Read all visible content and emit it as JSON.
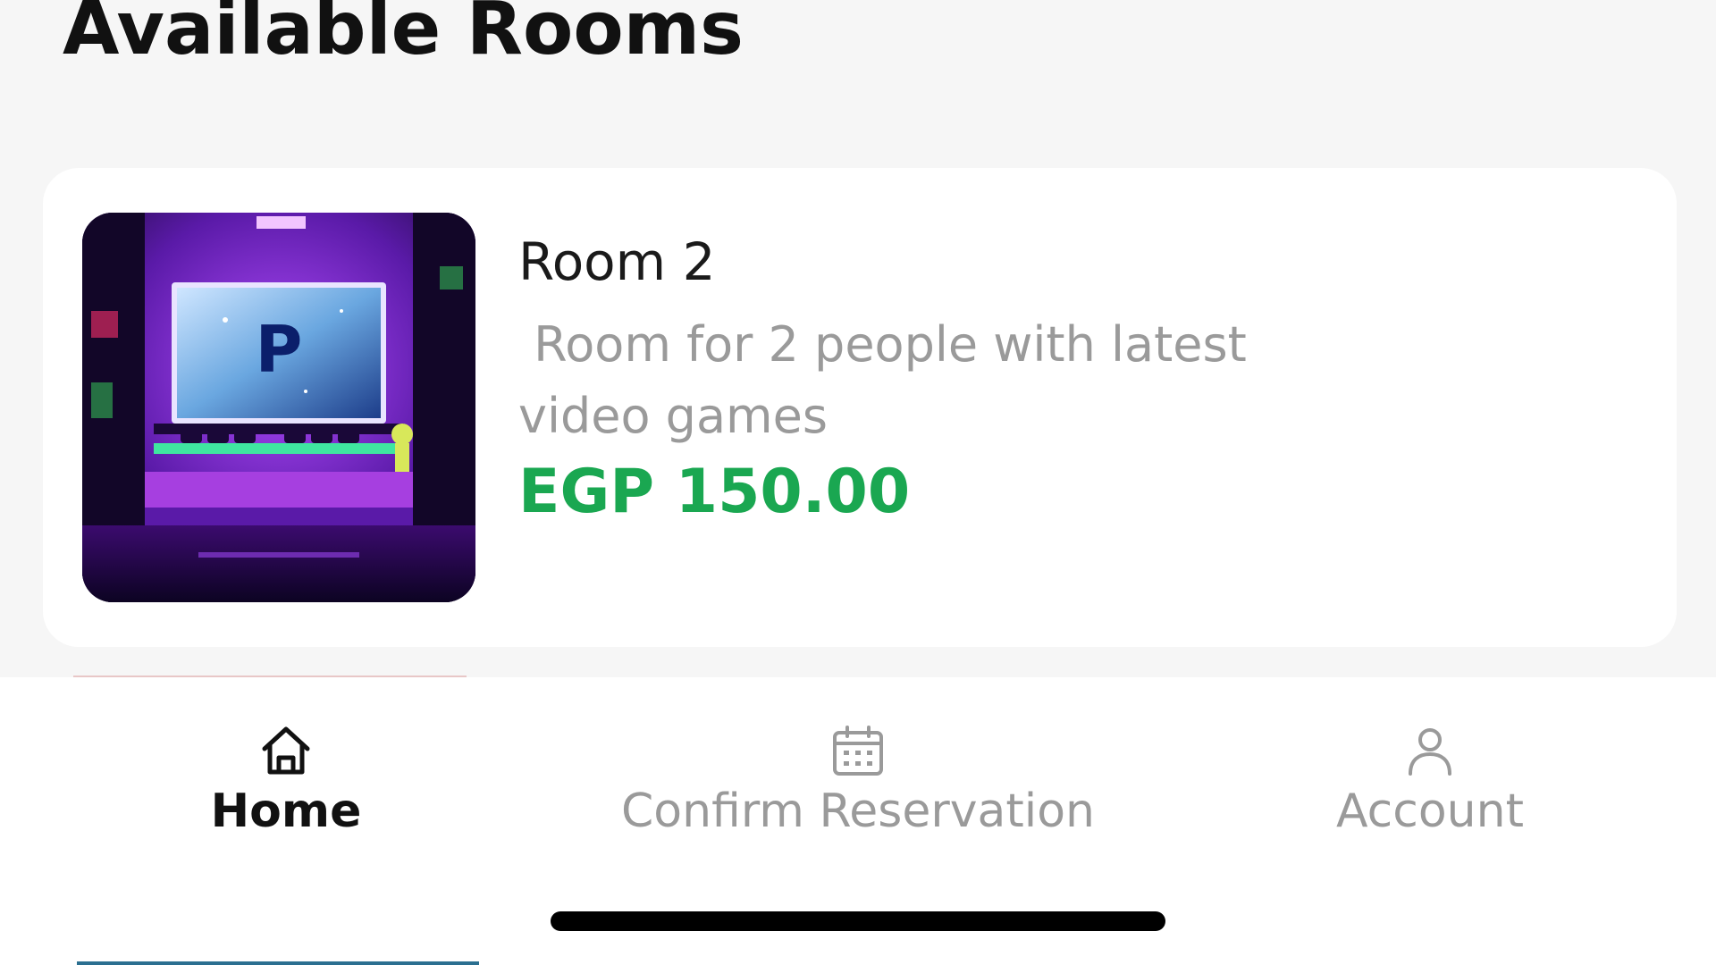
{
  "page": {
    "title": "Available Rooms"
  },
  "rooms": [
    {
      "name": "Room 2",
      "description": " Room for 2 people with latest video games",
      "price": "EGP 150.00",
      "image_icon": "gaming-room-image"
    }
  ],
  "bottom_nav": {
    "items": [
      {
        "label": "Home",
        "icon": "home-icon",
        "active": true
      },
      {
        "label": "Confirm Reservation",
        "icon": "calendar-icon",
        "active": false
      },
      {
        "label": "Account",
        "icon": "user-icon",
        "active": false
      }
    ]
  },
  "colors": {
    "background": "#f6f6f6",
    "card": "#ffffff",
    "price": "#1aa751",
    "text_primary": "#111111",
    "text_secondary": "#9a9a9a",
    "nav_inactive": "#9a9a9a"
  }
}
